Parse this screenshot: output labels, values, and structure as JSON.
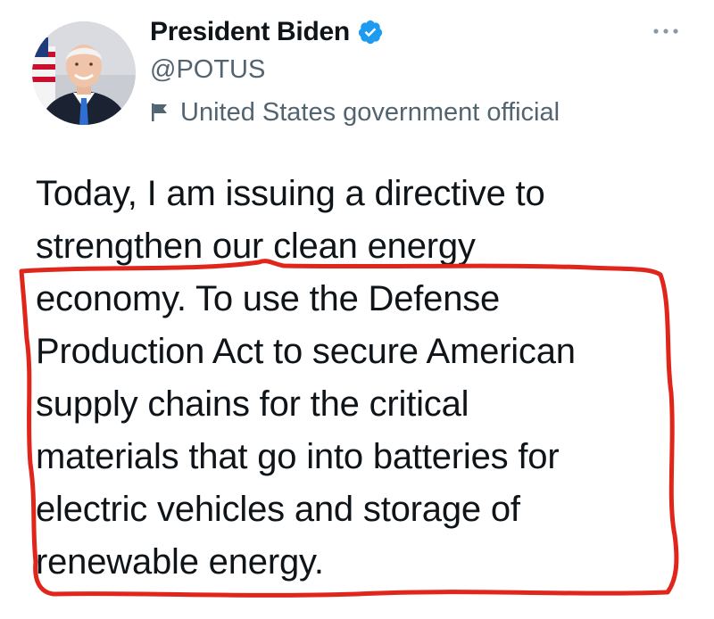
{
  "author": {
    "display_name": "President Biden",
    "handle": "@POTUS",
    "label": "United States government official",
    "verified": true
  },
  "icons": {
    "verified": "verified-badge-icon",
    "label": "flag-icon",
    "more": "more-horizontal-icon"
  },
  "colors": {
    "verified_blue": "#1d9bf0",
    "secondary_text": "#536471",
    "primary_text": "#0f1419",
    "annotation_red": "#e0261b"
  },
  "tweet": {
    "lines": [
      "Today, I am issuing a directive to",
      "strengthen our clean energy",
      "economy. To use the Defense",
      "Production Act to secure American",
      "supply chains for the critical",
      "materials that go into batteries for",
      "electric vehicles and storage of",
      "renewable energy."
    ]
  }
}
